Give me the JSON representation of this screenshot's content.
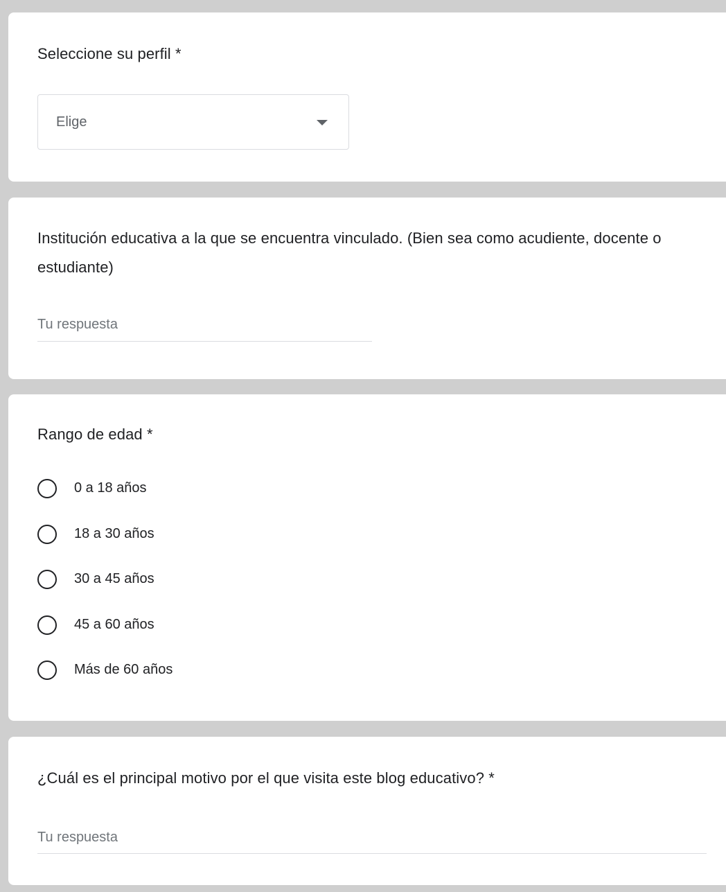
{
  "questions": {
    "profile": {
      "title": "Seleccione su perfil",
      "required_mark": "*",
      "dropdown_value": "Elige"
    },
    "institution": {
      "title": "Institución educativa a la que se encuentra vinculado. (Bien sea como acudiente, docente o estudiante)",
      "placeholder": "Tu respuesta"
    },
    "age_range": {
      "title": "Rango de edad",
      "required_mark": "*",
      "options": [
        "0 a 18 años",
        "18 a 30 años",
        "30 a 45 años",
        "45 a 60 años",
        "Más de 60 años"
      ]
    },
    "motive": {
      "title": "¿Cuál es el principal motivo por el que visita este blog educativo?",
      "required_mark": "*",
      "placeholder": "Tu respuesta"
    }
  },
  "icons": {
    "dropdown_caret": "caret-down-icon",
    "radio": "radio-unchecked-icon"
  },
  "colors": {
    "background": "#cfcfcf",
    "card": "#ffffff",
    "text": "#202124",
    "muted_text": "#5f6368",
    "divider": "#dadce0"
  }
}
